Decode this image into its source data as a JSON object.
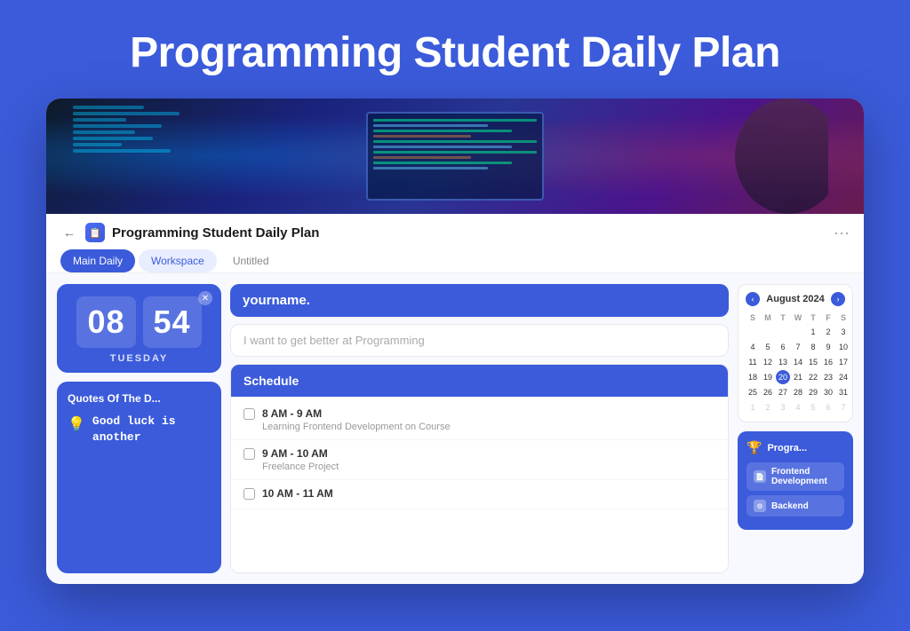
{
  "page": {
    "title": "Programming Student Daily Plan",
    "bg_color": "#3b5bdb"
  },
  "app": {
    "title": "Programming Student Daily Plan",
    "icon": "📋",
    "back_label": "←",
    "more_label": "···"
  },
  "tabs": [
    {
      "label": "Main Daily",
      "state": "active"
    },
    {
      "label": "Workspace",
      "state": "secondary"
    },
    {
      "label": "Untitled",
      "state": "plain"
    }
  ],
  "clock": {
    "hours": "08",
    "minutes": "54",
    "day": "TUESDAY"
  },
  "name_card": {
    "name": "yourname."
  },
  "goal_card": {
    "placeholder": "I want to get better at Programming"
  },
  "schedule": {
    "header": "Schedule",
    "items": [
      {
        "time": "8 AM - 9 AM",
        "description": "Learning Frontend Development on Course",
        "checked": false
      },
      {
        "time": "9 AM - 10 AM",
        "description": "Freelance Project",
        "checked": false
      },
      {
        "time": "10 AM - 11 AM",
        "description": "",
        "checked": false
      }
    ]
  },
  "calendar": {
    "month": "August 2024",
    "day_headers": [
      "S",
      "M",
      "T",
      "W",
      "T",
      "F",
      "S"
    ],
    "weeks": [
      [
        "",
        "",
        "",
        "",
        "1",
        "2",
        "3"
      ],
      [
        "4",
        "5",
        "6",
        "7",
        "8",
        "9",
        "10"
      ],
      [
        "11",
        "12",
        "13",
        "14",
        "15",
        "16",
        "17"
      ],
      [
        "18",
        "19",
        "20",
        "21",
        "22",
        "23",
        "24"
      ],
      [
        "25",
        "26",
        "27",
        "28",
        "29",
        "30",
        "31"
      ],
      [
        "1",
        "2",
        "3",
        "4",
        "5",
        "6",
        "7"
      ]
    ],
    "today": "20",
    "other_month_rows": [
      0,
      5
    ]
  },
  "quotes": {
    "title": "Quotes Of The D...",
    "icon": "💡",
    "text": "Good luck is another"
  },
  "progress": {
    "title": "Progra...",
    "icon": "🏆",
    "items": [
      {
        "label": "Frontend Development",
        "icon": "📄"
      },
      {
        "label": "Backend",
        "icon": "⚙"
      }
    ]
  }
}
